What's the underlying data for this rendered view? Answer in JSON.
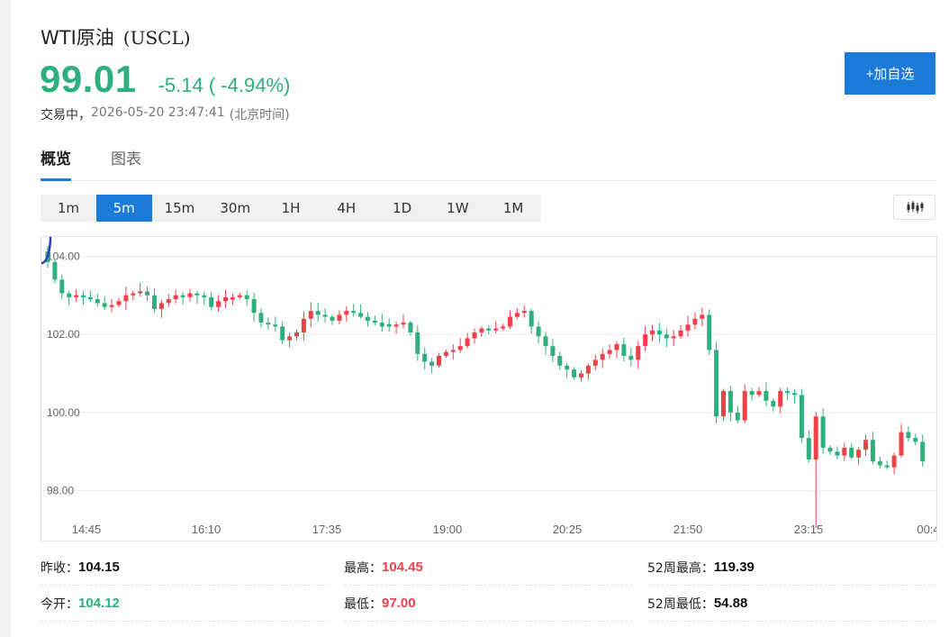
{
  "header": {
    "title": "WTI原油",
    "ticker": "(USCL)",
    "price": "99.01",
    "change": "-5.14 ( -4.94%)",
    "status": "交易中，",
    "timestamp": "2026-05-20 23:47:41",
    "timezone": "(北京时间)",
    "add_button": "+加自选",
    "price_color": "#2eaf7d"
  },
  "tabs": [
    {
      "label": "概览",
      "active": true
    },
    {
      "label": "图表",
      "active": false
    }
  ],
  "intervals": [
    {
      "label": "1m",
      "active": false
    },
    {
      "label": "5m",
      "active": true
    },
    {
      "label": "15m",
      "active": false
    },
    {
      "label": "30m",
      "active": false
    },
    {
      "label": "1H",
      "active": false
    },
    {
      "label": "4H",
      "active": false
    },
    {
      "label": "1D",
      "active": false
    },
    {
      "label": "1W",
      "active": false
    },
    {
      "label": "1M",
      "active": false
    }
  ],
  "chart_type_icon": "candlestick-icon",
  "colors": {
    "up": "#f0414a",
    "down": "#2eaf7d",
    "accent": "#1a7bd9",
    "highlight_circle": "#2a3fb8"
  },
  "chart_data": {
    "type": "candlestick",
    "y_ticks": [
      "104.00",
      "102.00",
      "100.00",
      "98.00"
    ],
    "y_tick_values": [
      104,
      102,
      100,
      98
    ],
    "x_ticks": [
      "14:45",
      "16:10",
      "17:35",
      "19:00",
      "20:25",
      "21:50",
      "23:15",
      "00:4"
    ],
    "ylim": [
      97.0,
      104.3
    ],
    "grid": true,
    "highlight": {
      "time_index": 133,
      "note": "circled candle"
    },
    "closes": [
      103.85,
      103.4,
      103.05,
      102.95,
      103.0,
      102.95,
      102.9,
      102.8,
      102.7,
      102.75,
      102.85,
      103.0,
      103.05,
      103.1,
      103.0,
      102.65,
      102.8,
      102.9,
      103.0,
      102.95,
      103.05,
      103.0,
      102.95,
      102.7,
      102.85,
      102.95,
      102.95,
      103.0,
      102.9,
      102.55,
      102.3,
      102.25,
      102.2,
      101.85,
      101.95,
      102.05,
      102.4,
      102.6,
      102.5,
      102.45,
      102.35,
      102.5,
      102.6,
      102.55,
      102.45,
      102.35,
      102.3,
      102.2,
      102.2,
      102.25,
      102.3,
      102.05,
      101.5,
      101.3,
      101.2,
      101.45,
      101.55,
      101.6,
      101.7,
      101.9,
      102.05,
      102.15,
      102.1,
      102.15,
      102.2,
      102.45,
      102.55,
      102.6,
      102.2,
      101.95,
      101.7,
      101.45,
      101.2,
      101.1,
      100.9,
      101.0,
      101.2,
      101.35,
      101.5,
      101.6,
      101.75,
      101.45,
      101.35,
      101.7,
      102.0,
      102.1,
      102.0,
      101.9,
      101.95,
      102.1,
      102.25,
      102.4,
      102.5,
      101.6,
      99.9,
      100.55,
      100.0,
      99.8,
      100.55,
      100.45,
      100.55,
      100.3,
      100.15,
      100.55,
      100.5,
      100.45,
      99.35,
      98.8,
      99.9,
      99.1,
      99.0,
      98.9,
      99.1,
      98.85,
      99.05,
      99.3,
      98.75,
      98.65,
      98.6,
      98.9,
      99.5,
      99.35,
      99.25,
      98.75
    ],
    "candle_count": 125
  },
  "stats": [
    {
      "label": "昨收：",
      "value": "104.15",
      "tone": "dark"
    },
    {
      "label": "最高：",
      "value": "104.45",
      "tone": "red"
    },
    {
      "label": "52周最高：",
      "value": "119.39",
      "tone": "dark"
    },
    {
      "label": "今开：",
      "value": "104.12",
      "tone": "green"
    },
    {
      "label": "最低：",
      "value": "97.00",
      "tone": "red"
    },
    {
      "label": "52周最低：",
      "value": "54.88",
      "tone": "dark"
    }
  ]
}
